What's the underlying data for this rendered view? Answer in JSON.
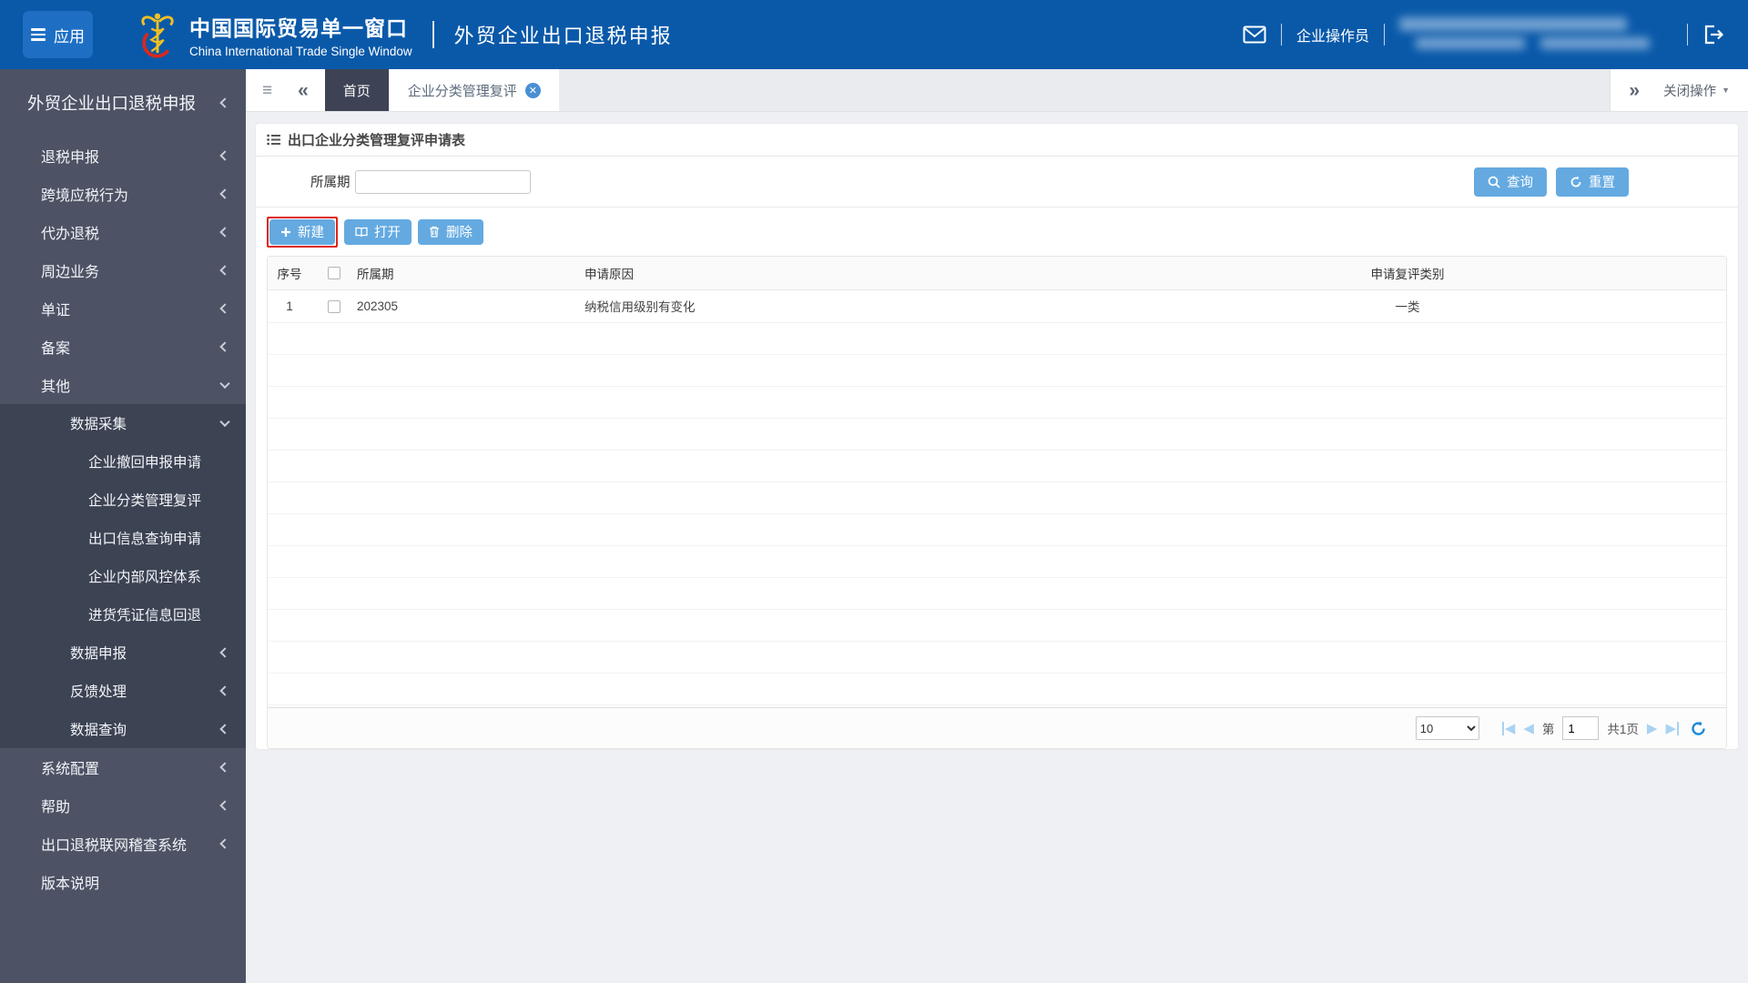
{
  "header": {
    "app_label": "应用",
    "brand_title": "中国国际贸易单一窗口",
    "brand_subtitle": "China International Trade Single Window",
    "module_title": "外贸企业出口退税申报",
    "operator": "企业操作员"
  },
  "tabbar": {
    "menu_icon": "≡",
    "collapse_icon": "«",
    "expand_icon": "»",
    "tabs": [
      {
        "label": "首页",
        "active": true
      },
      {
        "label": "企业分类管理复评",
        "closable": true
      }
    ],
    "close_ops_label": "关闭操作",
    "caret": "▼",
    "close_x": "✕"
  },
  "sidebar": {
    "title": "外贸企业出口退税申报",
    "items": [
      {
        "label": "退税申报",
        "level": 1,
        "chevron": "left"
      },
      {
        "label": "跨境应税行为",
        "level": 1,
        "chevron": "left"
      },
      {
        "label": "代办退税",
        "level": 1,
        "chevron": "left"
      },
      {
        "label": "周边业务",
        "level": 1,
        "chevron": "left"
      },
      {
        "label": "单证",
        "level": 1,
        "chevron": "left"
      },
      {
        "label": "备案",
        "level": 1,
        "chevron": "left"
      },
      {
        "label": "其他",
        "level": 1,
        "chevron": "down"
      },
      {
        "label": "数据采集",
        "level": 2,
        "chevron": "down",
        "dark": true
      },
      {
        "label": "企业撤回申报申请",
        "level": 3,
        "dark": true
      },
      {
        "label": "企业分类管理复评",
        "level": 3,
        "dark": true
      },
      {
        "label": "出口信息查询申请",
        "level": 3,
        "dark": true
      },
      {
        "label": "企业内部风控体系",
        "level": 3,
        "dark": true
      },
      {
        "label": "进货凭证信息回退",
        "level": 3,
        "dark": true
      },
      {
        "label": "数据申报",
        "level": 2,
        "chevron": "left",
        "dark": true
      },
      {
        "label": "反馈处理",
        "level": 2,
        "chevron": "left",
        "dark": true
      },
      {
        "label": "数据查询",
        "level": 2,
        "chevron": "left",
        "dark": true
      },
      {
        "label": "系统配置",
        "level": 1,
        "chevron": "left"
      },
      {
        "label": "帮助",
        "level": 1,
        "chevron": "left"
      },
      {
        "label": "出口退税联网稽查系统",
        "level": 1,
        "chevron": "left"
      },
      {
        "label": "版本说明",
        "level": 1
      }
    ]
  },
  "panel": {
    "title": "出口企业分类管理复评申请表",
    "query": {
      "period_label": "所属期",
      "period_value": "",
      "search_label": "查询",
      "reset_label": "重置"
    },
    "toolbar": {
      "new_label": "新建",
      "open_label": "打开",
      "delete_label": "删除"
    },
    "table": {
      "headers": {
        "seq": "序号",
        "period": "所属期",
        "reason": "申请原因",
        "category": "申请复评类别"
      },
      "rows": [
        {
          "seq": "1",
          "period": "202305",
          "reason": "纳税信用级别有变化",
          "category": "一类",
          "checked": false
        }
      ]
    },
    "pagination": {
      "page_size": "10",
      "page_prefix": "第",
      "page": "1",
      "total_pages": "共1页"
    }
  },
  "colors": {
    "header_blue": "#0a59a9",
    "app_button_blue": "#1e6fc4",
    "accent_button_blue": "#64aae1",
    "sidebar_bg": "#4d5365",
    "sidebar_dark_bg": "#3c4353",
    "active_tab_dark": "#3d4354",
    "highlight_red": "#e0241c",
    "refresh_blue": "#1b87d6"
  }
}
